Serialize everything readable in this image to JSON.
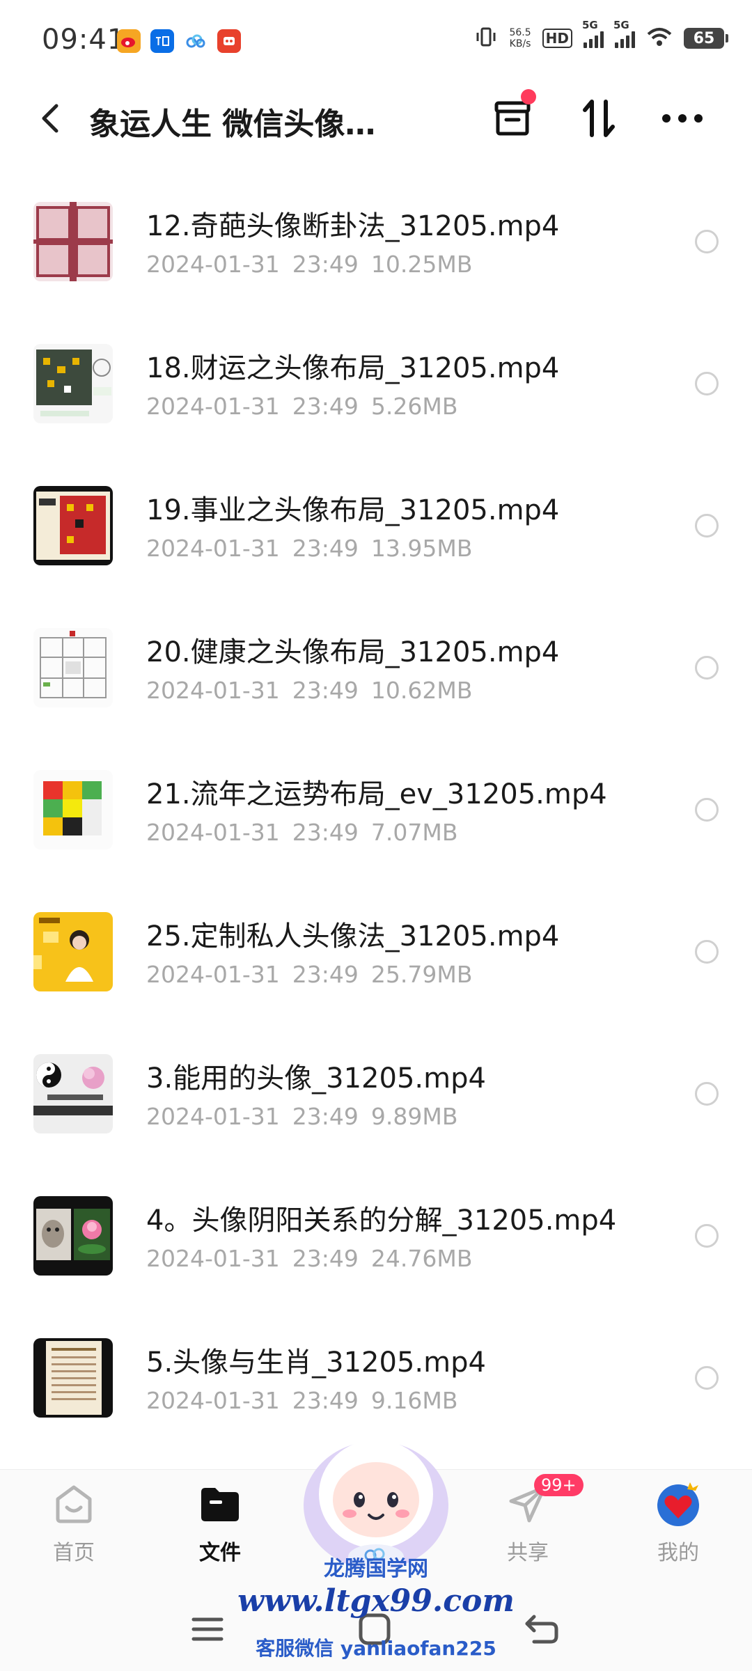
{
  "status_bar": {
    "time": "09:41",
    "app_icons": [
      "weibo-icon",
      "zhihu-icon",
      "cloud-icon",
      "game-icon"
    ],
    "speed_value": "56.5",
    "speed_unit": "KB/s",
    "hd_label": "HD",
    "sim1_label": "5G",
    "sim2_label": "5G",
    "battery": "65"
  },
  "title_bar": {
    "title": "象运人生 微信头像…"
  },
  "files": [
    {
      "name": "12.奇葩头像断卦法_31205.mp4",
      "date": "2024-01-31",
      "time": "23:49",
      "size": "10.25MB"
    },
    {
      "name": "18.财运之头像布局_31205.mp4",
      "date": "2024-01-31",
      "time": "23:49",
      "size": "5.26MB"
    },
    {
      "name": "19.事业之头像布局_31205.mp4",
      "date": "2024-01-31",
      "time": "23:49",
      "size": "13.95MB"
    },
    {
      "name": "20.健康之头像布局_31205.mp4",
      "date": "2024-01-31",
      "time": "23:49",
      "size": "10.62MB"
    },
    {
      "name": "21.流年之运势布局_ev_31205.mp4",
      "date": "2024-01-31",
      "time": "23:49",
      "size": "7.07MB"
    },
    {
      "name": "25.定制私人头像法_31205.mp4",
      "date": "2024-01-31",
      "time": "23:49",
      "size": "25.79MB"
    },
    {
      "name": "3.能用的头像_31205.mp4",
      "date": "2024-01-31",
      "time": "23:49",
      "size": "9.89MB"
    },
    {
      "name": "4。头像阴阳关系的分解_31205.mp4",
      "date": "2024-01-31",
      "time": "23:49",
      "size": "24.76MB"
    },
    {
      "name": "5.头像与生肖_31205.mp4",
      "date": "2024-01-31",
      "time": "23:49",
      "size": "9.16MB"
    }
  ],
  "bottom_nav": {
    "items": [
      {
        "label": "首页",
        "icon": "home-icon"
      },
      {
        "label": "文件",
        "icon": "folder-icon"
      },
      {
        "label": "共享",
        "icon": "send-icon",
        "badge": "99+"
      },
      {
        "label": "我的",
        "icon": "avatar-icon"
      }
    ]
  },
  "watermark": {
    "line1": "龙腾国学网",
    "line2": "www.ltgx99.com",
    "line3": "客服微信 yanliaofan225"
  },
  "colors": {
    "accent_red": "#ff3b5c",
    "meta_gray": "#a8a8a8",
    "watermark_blue": "#2a5cc8"
  }
}
